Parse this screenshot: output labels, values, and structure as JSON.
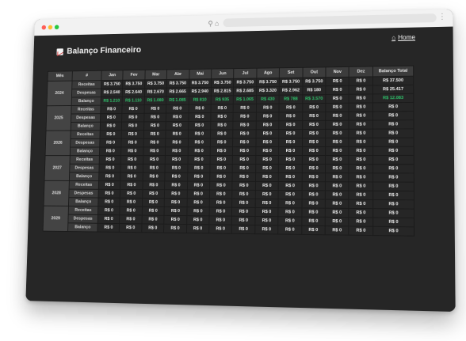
{
  "page": {
    "title": "Balanço Financeiro",
    "home_label": "Home"
  },
  "table": {
    "headers": [
      "Mês",
      "#",
      "Jan",
      "Fev",
      "Mar",
      "Abr",
      "Mai",
      "Jun",
      "Jul",
      "Ago",
      "Set",
      "Out",
      "Nov",
      "Dez",
      "Balanço Total"
    ],
    "years": [
      {
        "year": "2024",
        "rows": [
          {
            "label": "Receitas",
            "values": [
              "R$ 3.750",
              "R$ 3.750",
              "R$ 3.750",
              "R$ 3.750",
              "R$ 3.750",
              "R$ 3.750",
              "R$ 3.750",
              "R$ 3.750",
              "R$ 3.750",
              "R$ 3.750",
              "R$ 0",
              "R$ 0",
              "R$ 37.500"
            ],
            "positive": false
          },
          {
            "label": "Despesas",
            "values": [
              "R$ 2.540",
              "R$ 2.640",
              "R$ 2.670",
              "R$ 2.665",
              "R$ 2.940",
              "R$ 2.815",
              "R$ 2.685",
              "R$ 3.320",
              "R$ 2.962",
              "R$ 180",
              "R$ 0",
              "R$ 0",
              "R$ 25.417"
            ],
            "positive": false
          },
          {
            "label": "Balanço",
            "values": [
              "R$ 1.210",
              "R$ 1.110",
              "R$ 1.080",
              "R$ 1.085",
              "R$ 810",
              "R$ 935",
              "R$ 1.065",
              "R$ 430",
              "R$ 788",
              "R$ 3.570",
              "R$ 0",
              "R$ 0",
              "R$ 12.083"
            ],
            "positive": true
          }
        ]
      },
      {
        "year": "2025",
        "rows": [
          {
            "label": "Receitas",
            "values": [
              "R$ 0",
              "R$ 0",
              "R$ 0",
              "R$ 0",
              "R$ 0",
              "R$ 0",
              "R$ 0",
              "R$ 0",
              "R$ 0",
              "R$ 0",
              "R$ 0",
              "R$ 0",
              "R$ 0"
            ],
            "positive": false
          },
          {
            "label": "Despesas",
            "values": [
              "R$ 0",
              "R$ 0",
              "R$ 0",
              "R$ 0",
              "R$ 0",
              "R$ 0",
              "R$ 0",
              "R$ 0",
              "R$ 0",
              "R$ 0",
              "R$ 0",
              "R$ 0",
              "R$ 0"
            ],
            "positive": false
          },
          {
            "label": "Balanço",
            "values": [
              "R$ 0",
              "R$ 0",
              "R$ 0",
              "R$ 0",
              "R$ 0",
              "R$ 0",
              "R$ 0",
              "R$ 0",
              "R$ 0",
              "R$ 0",
              "R$ 0",
              "R$ 0",
              "R$ 0"
            ],
            "positive": false
          }
        ]
      },
      {
        "year": "2026",
        "rows": [
          {
            "label": "Receitas",
            "values": [
              "R$ 0",
              "R$ 0",
              "R$ 0",
              "R$ 0",
              "R$ 0",
              "R$ 0",
              "R$ 0",
              "R$ 0",
              "R$ 0",
              "R$ 0",
              "R$ 0",
              "R$ 0",
              "R$ 0"
            ],
            "positive": false
          },
          {
            "label": "Despesas",
            "values": [
              "R$ 0",
              "R$ 0",
              "R$ 0",
              "R$ 0",
              "R$ 0",
              "R$ 0",
              "R$ 0",
              "R$ 0",
              "R$ 0",
              "R$ 0",
              "R$ 0",
              "R$ 0",
              "R$ 0"
            ],
            "positive": false
          },
          {
            "label": "Balanço",
            "values": [
              "R$ 0",
              "R$ 0",
              "R$ 0",
              "R$ 0",
              "R$ 0",
              "R$ 0",
              "R$ 0",
              "R$ 0",
              "R$ 0",
              "R$ 0",
              "R$ 0",
              "R$ 0",
              "R$ 0"
            ],
            "positive": false
          }
        ]
      },
      {
        "year": "2027",
        "rows": [
          {
            "label": "Receitas",
            "values": [
              "R$ 0",
              "R$ 0",
              "R$ 0",
              "R$ 0",
              "R$ 0",
              "R$ 0",
              "R$ 0",
              "R$ 0",
              "R$ 0",
              "R$ 0",
              "R$ 0",
              "R$ 0",
              "R$ 0"
            ],
            "positive": false
          },
          {
            "label": "Despesas",
            "values": [
              "R$ 0",
              "R$ 0",
              "R$ 0",
              "R$ 0",
              "R$ 0",
              "R$ 0",
              "R$ 0",
              "R$ 0",
              "R$ 0",
              "R$ 0",
              "R$ 0",
              "R$ 0",
              "R$ 0"
            ],
            "positive": false
          },
          {
            "label": "Balanço",
            "values": [
              "R$ 0",
              "R$ 0",
              "R$ 0",
              "R$ 0",
              "R$ 0",
              "R$ 0",
              "R$ 0",
              "R$ 0",
              "R$ 0",
              "R$ 0",
              "R$ 0",
              "R$ 0",
              "R$ 0"
            ],
            "positive": false
          }
        ]
      },
      {
        "year": "2028",
        "rows": [
          {
            "label": "Receitas",
            "values": [
              "R$ 0",
              "R$ 0",
              "R$ 0",
              "R$ 0",
              "R$ 0",
              "R$ 0",
              "R$ 0",
              "R$ 0",
              "R$ 0",
              "R$ 0",
              "R$ 0",
              "R$ 0",
              "R$ 0"
            ],
            "positive": false
          },
          {
            "label": "Despesas",
            "values": [
              "R$ 0",
              "R$ 0",
              "R$ 0",
              "R$ 0",
              "R$ 0",
              "R$ 0",
              "R$ 0",
              "R$ 0",
              "R$ 0",
              "R$ 0",
              "R$ 0",
              "R$ 0",
              "R$ 0"
            ],
            "positive": false
          },
          {
            "label": "Balanço",
            "values": [
              "R$ 0",
              "R$ 0",
              "R$ 0",
              "R$ 0",
              "R$ 0",
              "R$ 0",
              "R$ 0",
              "R$ 0",
              "R$ 0",
              "R$ 0",
              "R$ 0",
              "R$ 0",
              "R$ 0"
            ],
            "positive": false
          }
        ]
      },
      {
        "year": "2029",
        "rows": [
          {
            "label": "Receitas",
            "values": [
              "R$ 0",
              "R$ 0",
              "R$ 0",
              "R$ 0",
              "R$ 0",
              "R$ 0",
              "R$ 0",
              "R$ 0",
              "R$ 0",
              "R$ 0",
              "R$ 0",
              "R$ 0",
              "R$ 0"
            ],
            "positive": false
          },
          {
            "label": "Despesas",
            "values": [
              "R$ 0",
              "R$ 0",
              "R$ 0",
              "R$ 0",
              "R$ 0",
              "R$ 0",
              "R$ 0",
              "R$ 0",
              "R$ 0",
              "R$ 0",
              "R$ 0",
              "R$ 0",
              "R$ 0"
            ],
            "positive": false
          },
          {
            "label": "Balanço",
            "values": [
              "R$ 0",
              "R$ 0",
              "R$ 0",
              "R$ 0",
              "R$ 0",
              "R$ 0",
              "R$ 0",
              "R$ 0",
              "R$ 0",
              "R$ 0",
              "R$ 0",
              "R$ 0",
              "R$ 0"
            ],
            "positive": false
          }
        ]
      }
    ]
  },
  "colors": {
    "positive_balance": "#2fc36b",
    "background": "#262626",
    "header": "#3c3c3c"
  }
}
